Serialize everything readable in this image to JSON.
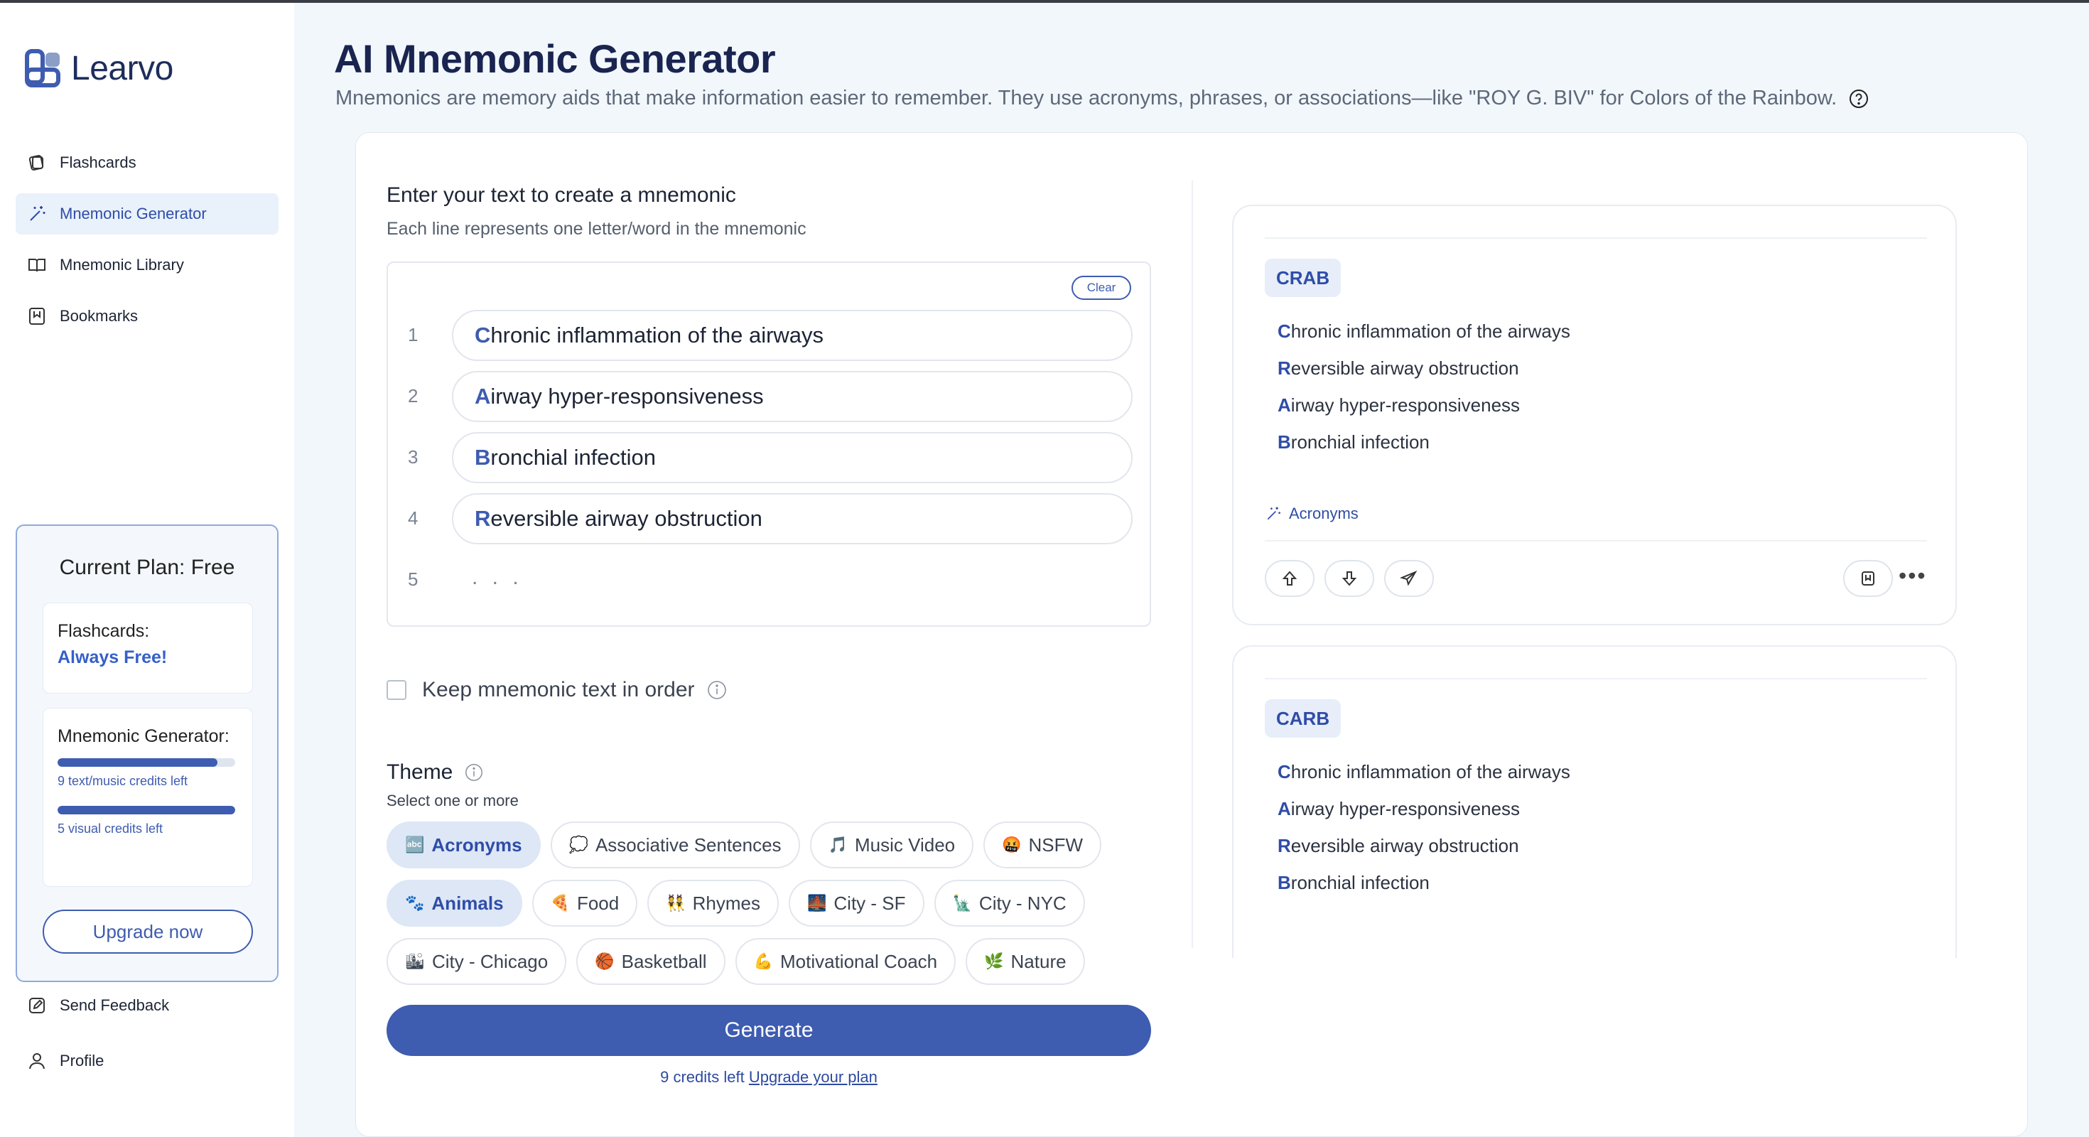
{
  "app": {
    "brand": "Learvo"
  },
  "sidebar": {
    "items": [
      {
        "label": "Flashcards",
        "icon": "cards-icon"
      },
      {
        "label": "Mnemonic Generator",
        "icon": "magic-wand-icon"
      },
      {
        "label": "Mnemonic Library",
        "icon": "book-icon"
      },
      {
        "label": "Bookmarks",
        "icon": "bookmark-icon"
      }
    ],
    "bottom_items": [
      {
        "label": "Send Feedback",
        "icon": "feedback-icon"
      },
      {
        "label": "Profile",
        "icon": "user-icon"
      }
    ],
    "plan": {
      "title": "Current Plan: Free",
      "flashcards_label": "Flashcards:",
      "flashcards_value": "Always Free!",
      "mnemonic_label": "Mnemonic Generator:",
      "text_credits_text": "9 text/music credits left",
      "text_credits_fraction": 0.9,
      "visual_credits_text": "5 visual credits left",
      "visual_credits_fraction": 1.0,
      "upgrade_label": "Upgrade now"
    }
  },
  "header": {
    "title": "AI Mnemonic Generator",
    "subtitle": "Mnemonics are memory aids that make information easier to remember. They use acronyms, phrases, or associations—like \"ROY G. BIV\" for Colors of the Rainbow."
  },
  "input": {
    "title": "Enter your text to create a mnemonic",
    "subtitle": "Each line represents one letter/word in the mnemonic",
    "clear_label": "Clear",
    "lines": [
      {
        "num": "1",
        "first": "C",
        "rest": "hronic inflammation of the airways"
      },
      {
        "num": "2",
        "first": "A",
        "rest": "irway hyper-responsiveness"
      },
      {
        "num": "3",
        "first": "B",
        "rest": "ronchial infection"
      },
      {
        "num": "4",
        "first": "R",
        "rest": "eversible airway obstruction"
      }
    ],
    "empty_line_num": "5",
    "empty_line_placeholder": ". . .",
    "keep_order_label": "Keep mnemonic text in order"
  },
  "theme": {
    "title": "Theme",
    "subtitle": "Select one or more",
    "rows": [
      [
        {
          "emoji": "🔤",
          "label": "Acronyms",
          "selected": true
        },
        {
          "emoji": "💭",
          "label": "Associative Sentences",
          "selected": false
        },
        {
          "emoji": "🎵",
          "label": "Music Video",
          "selected": false
        },
        {
          "emoji": "🤬",
          "label": "NSFW",
          "selected": false
        }
      ],
      [
        {
          "emoji": "🐾",
          "label": "Animals",
          "selected": true
        },
        {
          "emoji": "🍕",
          "label": "Food",
          "selected": false
        },
        {
          "emoji": "👯",
          "label": "Rhymes",
          "selected": false
        },
        {
          "emoji": "🌉",
          "label": "City - SF",
          "selected": false
        },
        {
          "emoji": "🗽",
          "label": "City - NYC",
          "selected": false
        }
      ],
      [
        {
          "emoji": "🏙",
          "label": "City - Chicago",
          "selected": false
        },
        {
          "emoji": "🏀",
          "label": "Basketball",
          "selected": false
        },
        {
          "emoji": "💪",
          "label": "Motivational Coach",
          "selected": false
        },
        {
          "emoji": "🌿",
          "label": "Nature",
          "selected": false
        }
      ]
    ]
  },
  "generate": {
    "label": "Generate",
    "credits_text": "9 credits left",
    "upgrade_link": "Upgrade your plan"
  },
  "results": [
    {
      "acronym": "CRAB",
      "lines": [
        {
          "first": "C",
          "rest": "hronic inflammation of the airways"
        },
        {
          "first": "R",
          "rest": "eversible airway obstruction"
        },
        {
          "first": "A",
          "rest": "irway hyper-responsiveness"
        },
        {
          "first": "B",
          "rest": "ronchial infection"
        }
      ],
      "tag": "Acronyms"
    },
    {
      "acronym": "CARB",
      "lines": [
        {
          "first": "C",
          "rest": "hronic inflammation of the airways"
        },
        {
          "first": "A",
          "rest": "irway hyper-responsiveness"
        },
        {
          "first": "R",
          "rest": "eversible airway obstruction"
        },
        {
          "first": "B",
          "rest": "ronchial infection"
        }
      ]
    }
  ],
  "colors": {
    "accent": "#3e5cb0",
    "brand_dark": "#1d2d5c",
    "background": "#f2f7fc"
  }
}
